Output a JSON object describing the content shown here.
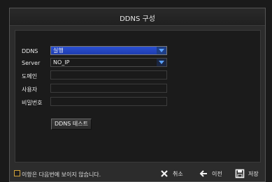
{
  "dialog": {
    "title": "DDNS 구성"
  },
  "form": {
    "ddns": {
      "label": "DDNS",
      "value": "실행"
    },
    "server": {
      "label": "Server",
      "value": "NO_IP"
    },
    "domain": {
      "label": "도메인",
      "value": ""
    },
    "user": {
      "label": "사용자",
      "value": ""
    },
    "password": {
      "label": "비밀번호",
      "value": ""
    },
    "test_button": "DDNS 테스트"
  },
  "footer": {
    "checkbox_label": "이항은 다음번에 보이지 않습니다.",
    "cancel_label": "취소",
    "back_label": "이전",
    "save_label": "저장"
  },
  "icons": {
    "cancel": "close-icon",
    "back": "arrow-left-icon",
    "save": "floppy-disk-icon"
  },
  "colors": {
    "checkbox_border": "#d2a23a",
    "selected_field": "#2a4fd1"
  }
}
